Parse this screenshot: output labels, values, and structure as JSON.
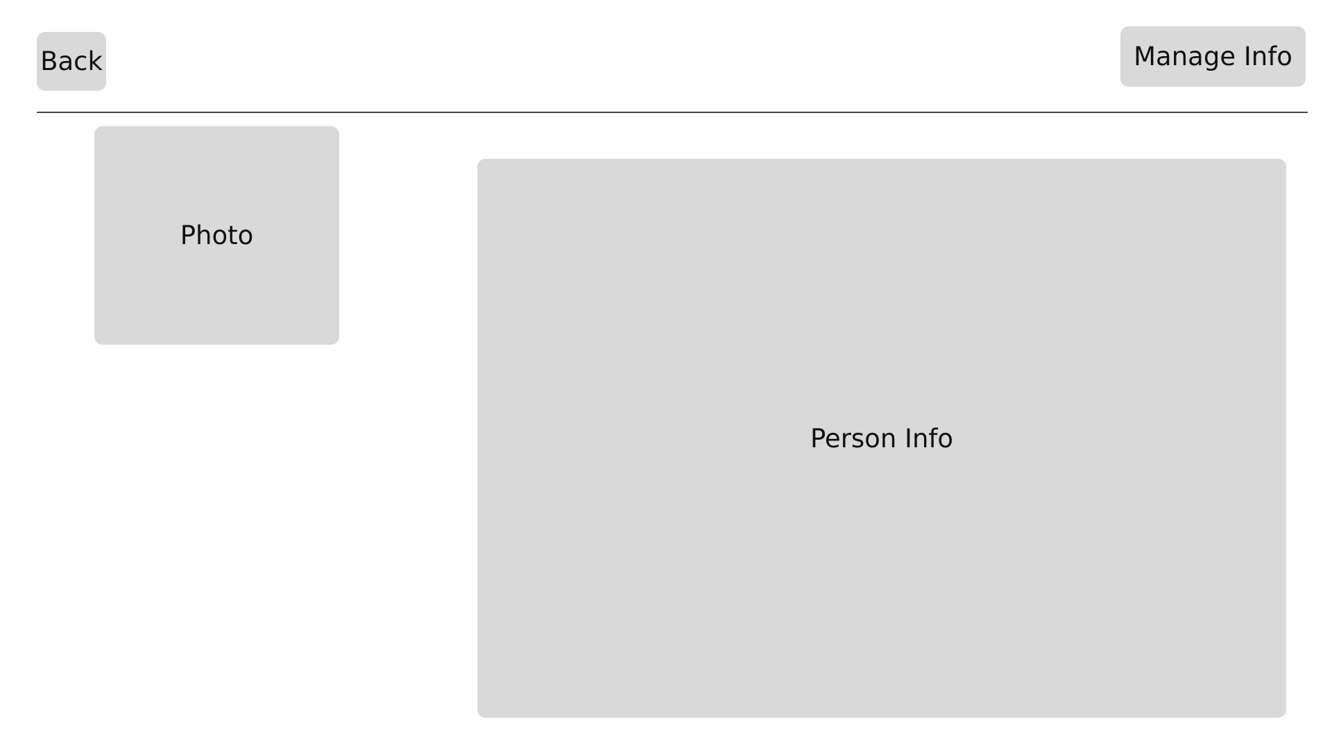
{
  "header": {
    "back_label": "Back",
    "manage_info_label": "Manage Info"
  },
  "main": {
    "photo_label": "Photo",
    "person_info_label": "Person Info"
  },
  "colors": {
    "panel_background": "#d9d9d9",
    "divider": "#444444",
    "page_background": "#ffffff"
  }
}
